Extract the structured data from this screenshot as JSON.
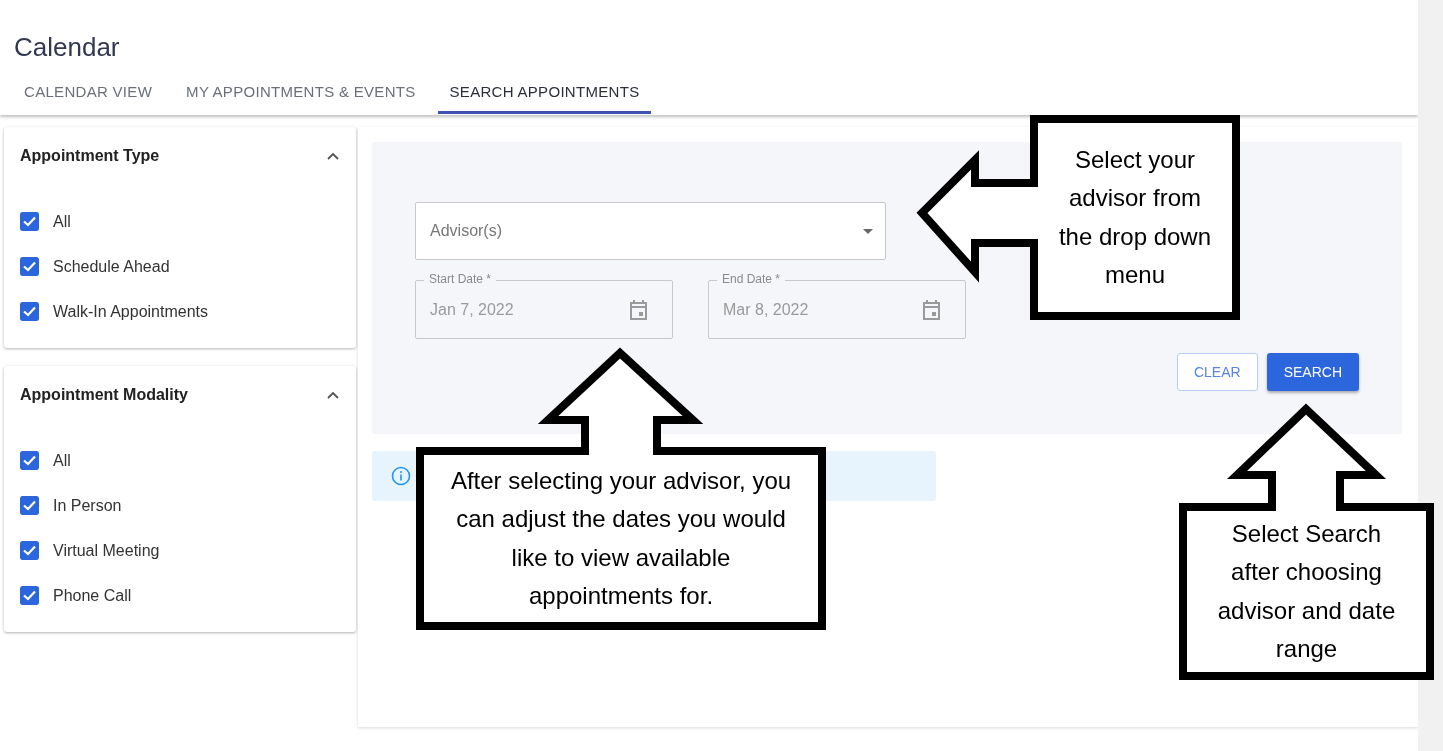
{
  "header": {
    "title": "Calendar"
  },
  "tabs": [
    {
      "label": "CALENDAR VIEW",
      "selected": false
    },
    {
      "label": "MY APPOINTMENTS & EVENTS",
      "selected": false
    },
    {
      "label": "SEARCH APPOINTMENTS",
      "selected": true
    }
  ],
  "filters": [
    {
      "title": "Appointment Type",
      "expanded": true,
      "options": [
        {
          "label": "All",
          "checked": true
        },
        {
          "label": "Schedule Ahead",
          "checked": true
        },
        {
          "label": "Walk-In Appointments",
          "checked": true
        }
      ]
    },
    {
      "title": "Appointment Modality",
      "expanded": true,
      "options": [
        {
          "label": "All",
          "checked": true
        },
        {
          "label": "In Person",
          "checked": true
        },
        {
          "label": "Virtual Meeting",
          "checked": true
        },
        {
          "label": "Phone Call",
          "checked": true
        }
      ]
    }
  ],
  "search_form": {
    "advisor_field": {
      "placeholder": "Advisor(s)"
    },
    "date_fields": [
      {
        "label": "Start Date *",
        "value": "Jan 7, 2022"
      },
      {
        "label": "End Date *",
        "value": "Mar 8, 2022"
      }
    ],
    "buttons": [
      {
        "label": "CLEAR",
        "kind": "outlined"
      },
      {
        "label": "SEARCH",
        "kind": "filled"
      }
    ]
  },
  "info_banner": {
    "kind": "info"
  },
  "callouts": [
    {
      "text": "Select your advisor from the drop down menu",
      "kind": "left"
    },
    {
      "text": "After selecting your advisor, you can adjust the dates you would like to view available appointments for.",
      "kind": "up"
    },
    {
      "text": "Select Search after choosing advisor and date range",
      "kind": "up"
    }
  ]
}
